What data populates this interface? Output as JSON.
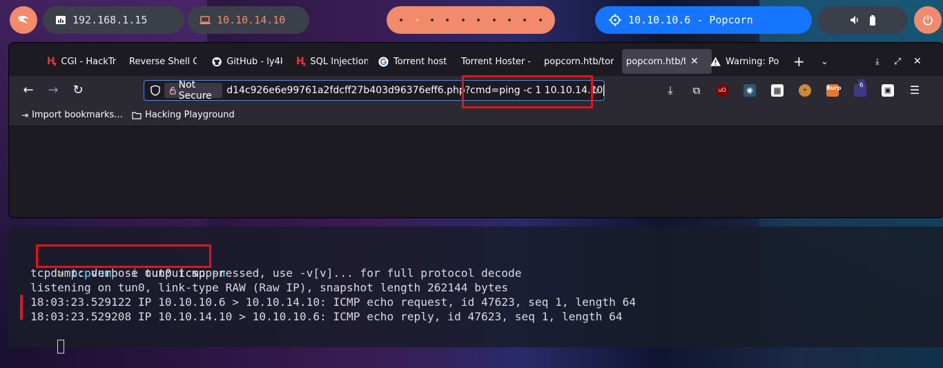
{
  "panel": {
    "local_ip": "192.168.1.15",
    "vpn_ip": "10.10.14.10",
    "target": "10.10.10.6 - Popcorn",
    "icons": [
      "kali-dragon-icon",
      "network-icon",
      "laptop-icon",
      "crosshair-icon",
      "volume-icon",
      "battery-icon",
      "power-icon"
    ]
  },
  "browser": {
    "tabs": [
      {
        "label": "CGI - HackTr",
        "icon": "hacktricks-icon"
      },
      {
        "label": "Reverse Shell Ch",
        "icon": ""
      },
      {
        "label": "GitHub - ly4k",
        "icon": "github-icon"
      },
      {
        "label": "SQL Injection",
        "icon": "hacktricks-icon"
      },
      {
        "label": "Torrent host",
        "icon": "google-icon"
      },
      {
        "label": "Torrent Hoster -",
        "icon": ""
      },
      {
        "label": "popcorn.htb/tor",
        "icon": ""
      },
      {
        "label": "popcorn.htb/t",
        "icon": "",
        "active": true
      },
      {
        "label": "Warning: Po",
        "icon": "warning-icon"
      }
    ],
    "url_security": "Not Secure",
    "url": "d14c926e6e99761a2fdcff27b403d96376eff6.php?cmd=ping -c 1 10.10.14.10",
    "bookmarks": [
      {
        "label": "Import bookmarks...",
        "icon": "import-icon"
      },
      {
        "label": "Hacking Playground",
        "icon": "folder-icon"
      }
    ],
    "ext_badge": "6",
    "burp_label": "Burp"
  },
  "terminal": {
    "prompt": ">",
    "command": "tcpdump",
    "flag_i": "-i",
    "iface": "tun0",
    "filter": "icmp",
    "flag_n": "-n",
    "lines": [
      "tcpdump: verbose output suppressed, use -v[v]... for full protocol decode",
      "listening on tun0, link-type RAW (Raw IP), snapshot length 262144 bytes",
      "18:03:23.529122 IP 10.10.10.6 > 10.10.14.10: ICMP echo request, id 47623, seq 1, length 64",
      "18:03:23.529208 IP 10.10.14.10 > 10.10.10.6: ICMP echo reply, id 47623, seq 1, length 64"
    ]
  }
}
